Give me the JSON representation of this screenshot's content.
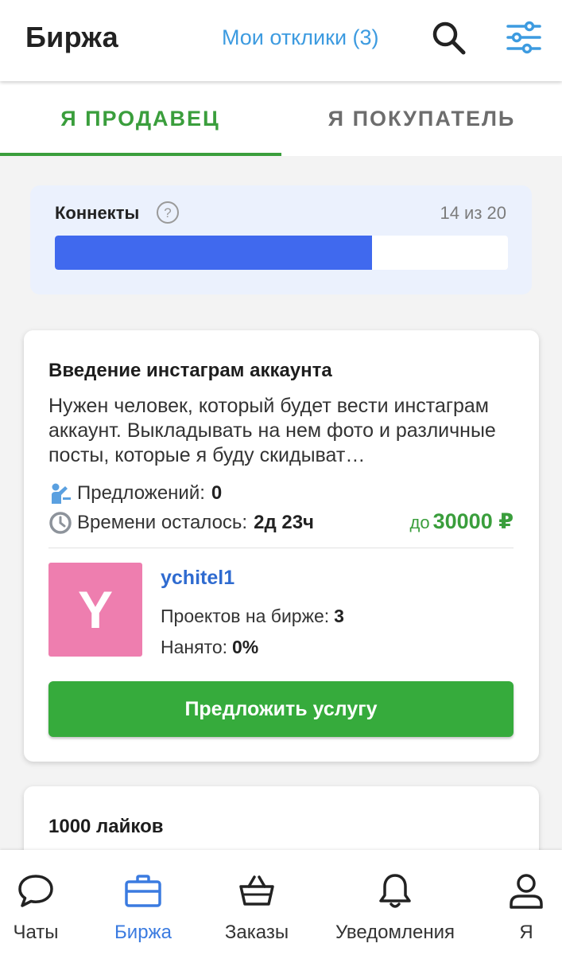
{
  "header": {
    "title": "Биржа",
    "my_responses": "Мои отклики (3)",
    "accent": "#3d9be0"
  },
  "tabs": [
    {
      "label": "Я ПРОДАВЕЦ",
      "active": true
    },
    {
      "label": "Я ПОКУПАТЕЛЬ",
      "active": false
    }
  ],
  "connects": {
    "label": "Коннекты",
    "count_text": "14 из 20",
    "used": 14,
    "total": 20,
    "fill_color": "#4069ee"
  },
  "card": {
    "title": "Введение инстаграм аккаунта",
    "description": "Нужен человек, который будет вести инстаграм аккаунт. Выкладывать на нем фото и различные посты, которые я буду скидыват…",
    "offers_label": "Предложений:",
    "offers_value": "0",
    "time_label": "Времени осталось:",
    "time_value": "2д 23ч",
    "price_prefix": "до",
    "price_value": "30000 ₽",
    "author": {
      "avatar_letter": "Y",
      "avatar_color": "#ee7eaf",
      "username": "ychitel1",
      "projects_label": "Проектов на бирже:",
      "projects_value": "3",
      "hired_label": "Нанято:",
      "hired_value": "0%"
    },
    "offer_button": "Предложить услугу"
  },
  "card2": {
    "title": "1000 лайков"
  },
  "bottom_nav": [
    {
      "label": "Чаты",
      "icon": "chat-icon",
      "active": false
    },
    {
      "label": "Биржа",
      "icon": "briefcase-icon",
      "active": true
    },
    {
      "label": "Заказы",
      "icon": "basket-icon",
      "active": false
    },
    {
      "label": "Уведомления",
      "icon": "bell-icon",
      "active": false
    },
    {
      "label": "Я",
      "icon": "user-icon",
      "active": false
    }
  ]
}
